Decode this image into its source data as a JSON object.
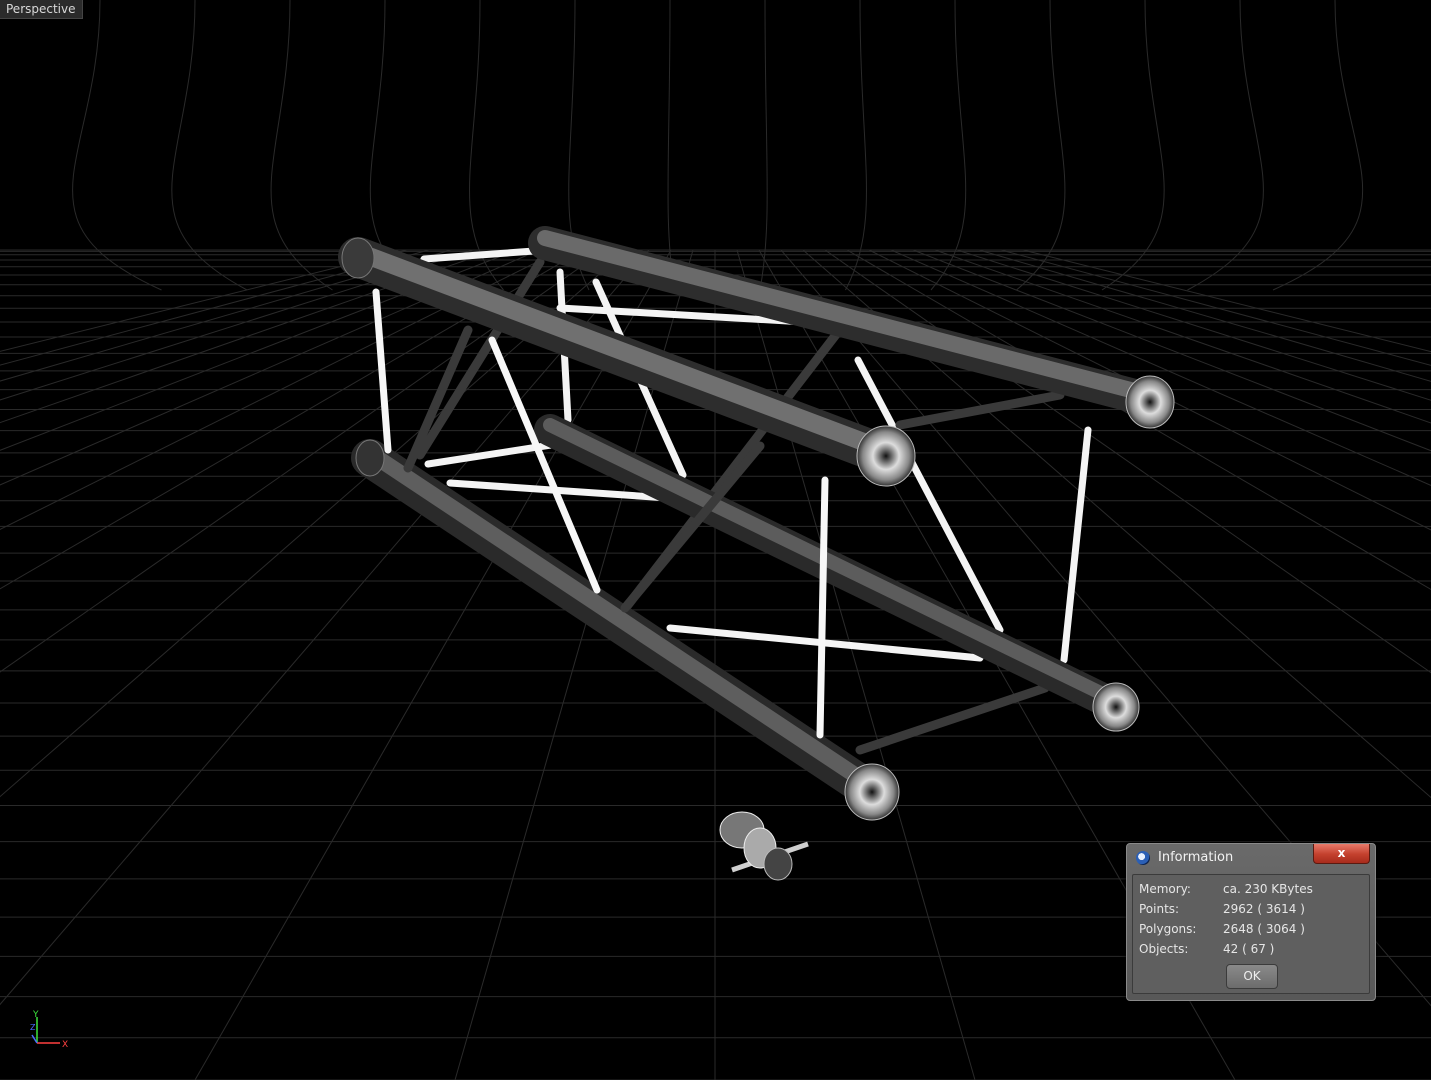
{
  "viewport": {
    "label": "Perspective",
    "axes": {
      "y": "Y",
      "x": "X",
      "z": "Z"
    }
  },
  "info_dialog": {
    "title": "Information",
    "close_label": "x",
    "rows": [
      {
        "label": "Memory:",
        "value": "ca. 230 KBytes"
      },
      {
        "label": "Points:",
        "value": "2962 ( 3614 )"
      },
      {
        "label": "Polygons:",
        "value": "2648 ( 3064 )"
      },
      {
        "label": "Objects:",
        "value": "42 ( 67 )"
      }
    ],
    "ok_label": "OK"
  },
  "colors": {
    "background": "#000000",
    "grid": "#2a2a2a",
    "truss_tube": "#5e5e5e",
    "brace": "#f2f2f2"
  },
  "icons": [
    "cinema4d-app-icon",
    "close-icon"
  ]
}
